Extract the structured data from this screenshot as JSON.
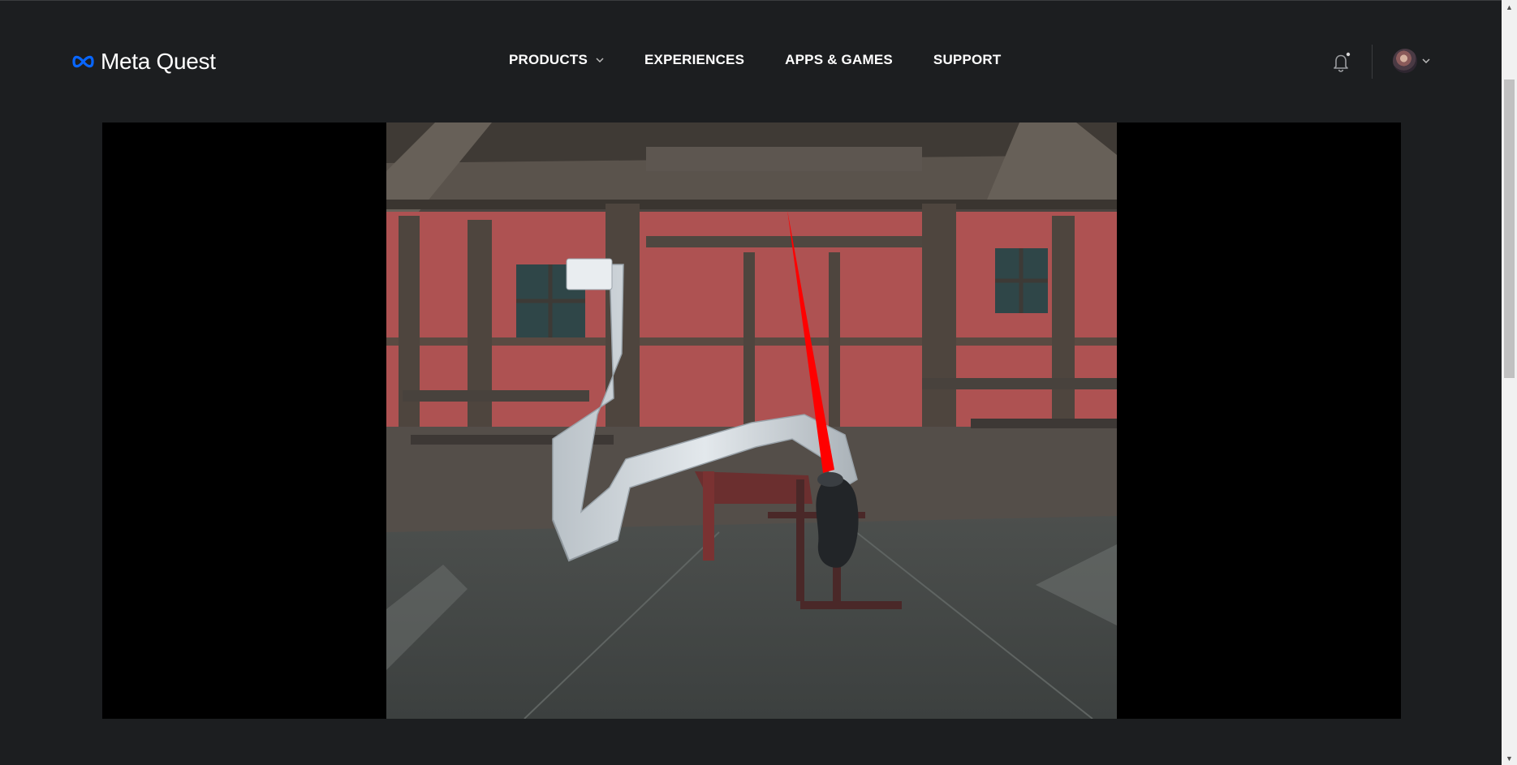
{
  "brand": {
    "name": "Meta Quest",
    "logo_icon": "meta-infinity-icon",
    "color": "#0866ff"
  },
  "nav": {
    "items": [
      {
        "label": "PRODUCTS",
        "has_dropdown": true
      },
      {
        "label": "EXPERIENCES",
        "has_dropdown": false
      },
      {
        "label": "APPS & GAMES",
        "has_dropdown": false
      },
      {
        "label": "SUPPORT",
        "has_dropdown": false
      }
    ]
  },
  "header_actions": {
    "notification_icon": "bell-icon",
    "has_unread": true,
    "profile_icon": "avatar",
    "profile_menu_icon": "chevron-down-icon"
  },
  "media": {
    "type": "video",
    "scene": "VR view: red laser from a controller next to a long curved stack of white blocks inside a wooden barn"
  },
  "theme": {
    "background": "#1c1e20",
    "video_background": "#000000",
    "laser": "#ff0000"
  }
}
